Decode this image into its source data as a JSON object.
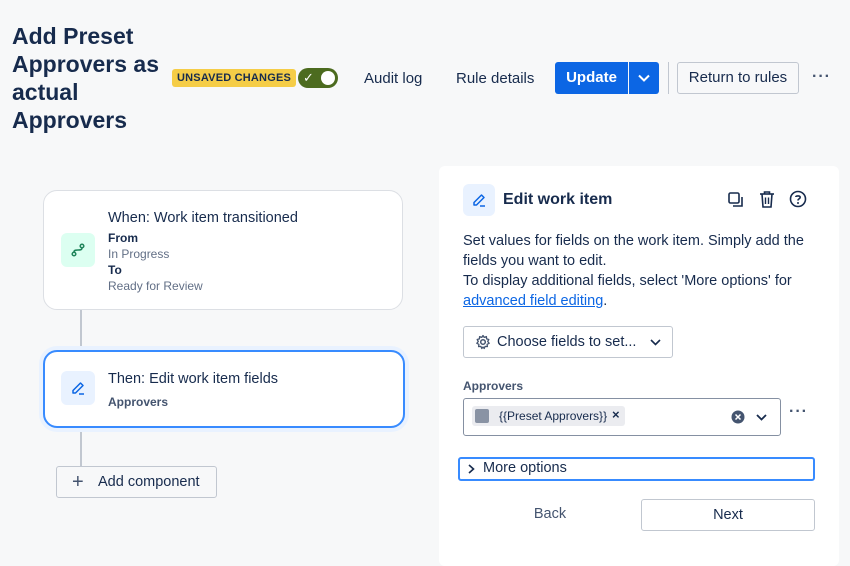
{
  "header": {
    "title": "Add Preset Approvers as actual Approvers",
    "badge": "UNSAVED CHANGES",
    "toggle_on": true,
    "audit_log": "Audit log",
    "rule_details": "Rule details",
    "update": "Update",
    "return_to_rules": "Return to rules",
    "more": "···"
  },
  "flow": {
    "trigger": {
      "title": "When: Work item transitioned",
      "from_label": "From",
      "from_value": "In Progress",
      "to_label": "To",
      "to_value": "Ready for Review",
      "icon": "branch-icon",
      "icon_bg": "#dcfff1",
      "icon_color": "#1f845a"
    },
    "action": {
      "title": "Then: Edit work item fields",
      "subtitle": "Approvers",
      "icon": "edit-icon",
      "icon_bg": "#e9f2ff",
      "icon_color": "#0c66e4"
    },
    "add_component": "Add component"
  },
  "panel": {
    "title": "Edit work item",
    "description_1": "Set values for fields on the work item. Simply add the fields you want to edit.",
    "description_2": "To display additional fields, select 'More options' for",
    "description_link": "advanced field editing",
    "description_end": ".",
    "choose_fields": "Choose fields to set...",
    "approvers_label": "Approvers",
    "approvers_chip": "{{Preset Approvers}}",
    "more_options": "More options",
    "back": "Back",
    "next": "Next"
  }
}
